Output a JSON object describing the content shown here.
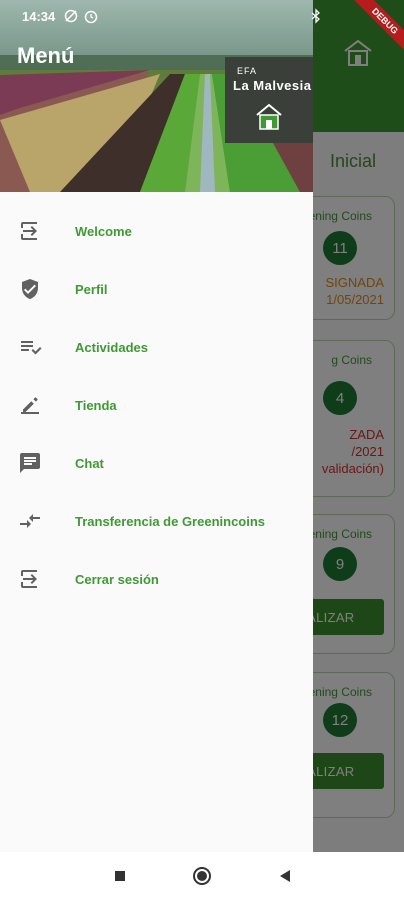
{
  "status_bar": {
    "time": "14:34",
    "debug_banner": "DEBUG"
  },
  "drawer": {
    "title": "Menú",
    "logo": {
      "line1": "EFA",
      "line2": "La Malvesia"
    },
    "items": [
      {
        "label": "Welcome",
        "icon": "login-icon"
      },
      {
        "label": "Perfil",
        "icon": "shield-check-icon"
      },
      {
        "label": "Actividades",
        "icon": "playlist-check-icon"
      },
      {
        "label": "Tienda",
        "icon": "edit-pencil-icon"
      },
      {
        "label": "Chat",
        "icon": "chat-icon"
      },
      {
        "label": "Transferencia de Greenincoins",
        "icon": "compare-arrows-icon"
      },
      {
        "label": "Cerrar sesión",
        "icon": "logout-icon"
      }
    ]
  },
  "background": {
    "title": "Inicial",
    "cards": [
      {
        "coins": "reening Coins",
        "value": "11",
        "status1": "SIGNADA",
        "status2": "1/05/2021",
        "status3": "",
        "button": ""
      },
      {
        "coins": "g Coins",
        "value": "4",
        "status1": "ZADA",
        "status2": "/2021",
        "status3": "validación)",
        "button": ""
      },
      {
        "coins": "eening Coins",
        "value": "9",
        "status1": "",
        "status2": "",
        "status3": "",
        "button": "REALIZAR"
      },
      {
        "coins": "eening Coins",
        "value": "12",
        "status1": "",
        "status2": "",
        "status3": "",
        "button": "REALIZAR"
      }
    ]
  },
  "colors": {
    "accent": "#3f9a34",
    "drawer_bg": "#fafafa",
    "icon": "#616161"
  }
}
